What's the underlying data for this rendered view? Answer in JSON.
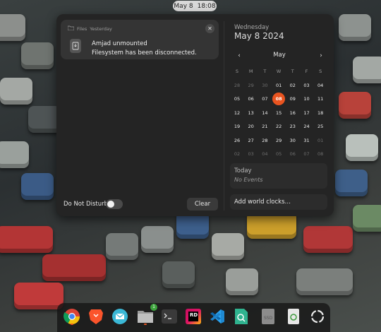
{
  "topbar": {
    "date": "May 8",
    "time": "18:08"
  },
  "notification": {
    "app": "Files",
    "time": "Yesterday",
    "title": "Amjad unmounted",
    "body": "Filesystem has been disconnected.",
    "icon": "drive-icon"
  },
  "dnd_label": "Do Not Disturb",
  "clear_label": "Clear",
  "calendar": {
    "weekday": "Wednesday",
    "date": "May 8 2024",
    "month": "May",
    "day_headers": [
      "S",
      "M",
      "T",
      "W",
      "T",
      "F",
      "S"
    ],
    "rows": [
      [
        "28",
        "29",
        "30",
        "01",
        "02",
        "03",
        "04"
      ],
      [
        "05",
        "06",
        "07",
        "08",
        "09",
        "10",
        "11"
      ],
      [
        "12",
        "13",
        "14",
        "15",
        "16",
        "17",
        "18"
      ],
      [
        "19",
        "20",
        "21",
        "22",
        "23",
        "24",
        "25"
      ],
      [
        "26",
        "27",
        "28",
        "29",
        "30",
        "31",
        "01"
      ],
      [
        "02",
        "03",
        "04",
        "05",
        "06",
        "07",
        "08"
      ]
    ],
    "today": "08"
  },
  "events": {
    "title": "Today",
    "empty": "No Events"
  },
  "world_clocks": "Add world clocks…",
  "dock": {
    "items": [
      "chrome-icon",
      "brave-icon",
      "mail-icon",
      "files-icon",
      "terminal-icon",
      "rider-icon",
      "vscode-icon",
      "search-icon",
      "ssd-icon",
      "trash-icon",
      "apps-grid-icon"
    ],
    "files_badge": "1",
    "ssd_label": "SSD",
    "rider_label": "RD"
  },
  "colors": {
    "accent": "#e95420",
    "panel": "#242424"
  }
}
